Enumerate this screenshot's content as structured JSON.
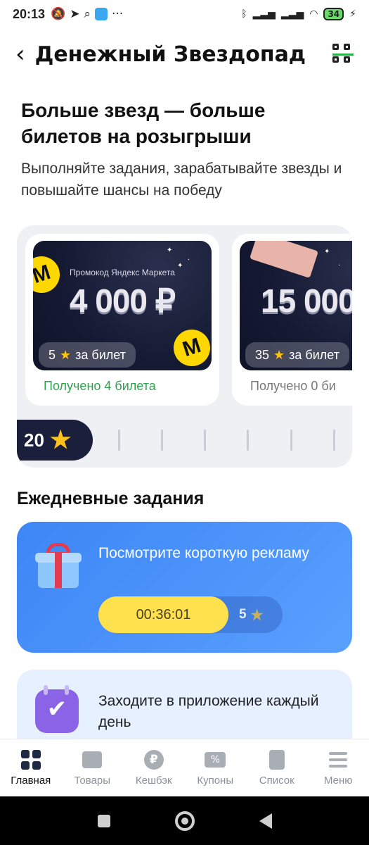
{
  "status_bar": {
    "time": "20:13",
    "battery": "34"
  },
  "header": {
    "back_glyph": "‹",
    "title": "Денежный Звездопад"
  },
  "hero": {
    "title": "Больше звезд — больше билетов на розыгрыши",
    "subtitle": "Выполняйте задания, зарабатывайте звезды и повышайте шансы на победу"
  },
  "prizes": [
    {
      "promo_label": "Промокод Яндекс Маркета",
      "amount": "4 000 ₽",
      "cost": "5",
      "cost_suffix": "за билет",
      "received": "Получено 4 билета",
      "accent": "#2fa44f"
    },
    {
      "promo_label": "",
      "amount": "15 000",
      "cost": "35",
      "cost_suffix": "за билет",
      "received": "Получено 0 би",
      "accent": "#777777"
    }
  ],
  "stars_balance": "20",
  "daily": {
    "title": "Ежедневные задания",
    "tasks": [
      {
        "text": "Посмотрите короткую рекламу",
        "timer": "00:36:01",
        "reward": "5"
      },
      {
        "text": "Заходите в приложение каждый день"
      }
    ]
  },
  "nav": {
    "items": [
      {
        "label": "Главная",
        "active": true
      },
      {
        "label": "Товары"
      },
      {
        "label": "Кешбэк"
      },
      {
        "label": "Купоны"
      },
      {
        "label": "Список"
      },
      {
        "label": "Меню"
      }
    ]
  },
  "colors": {
    "accent_blue": "#3d86f5",
    "star_yellow": "#ffc21a",
    "success_green": "#2fa44f"
  },
  "icons": [
    "back-icon",
    "qr-code-icon",
    "star-icon",
    "gift-icon",
    "calendar-check-icon",
    "home-icon",
    "shop-icon",
    "cashback-icon",
    "coupon-icon",
    "list-icon",
    "menu-icon"
  ]
}
